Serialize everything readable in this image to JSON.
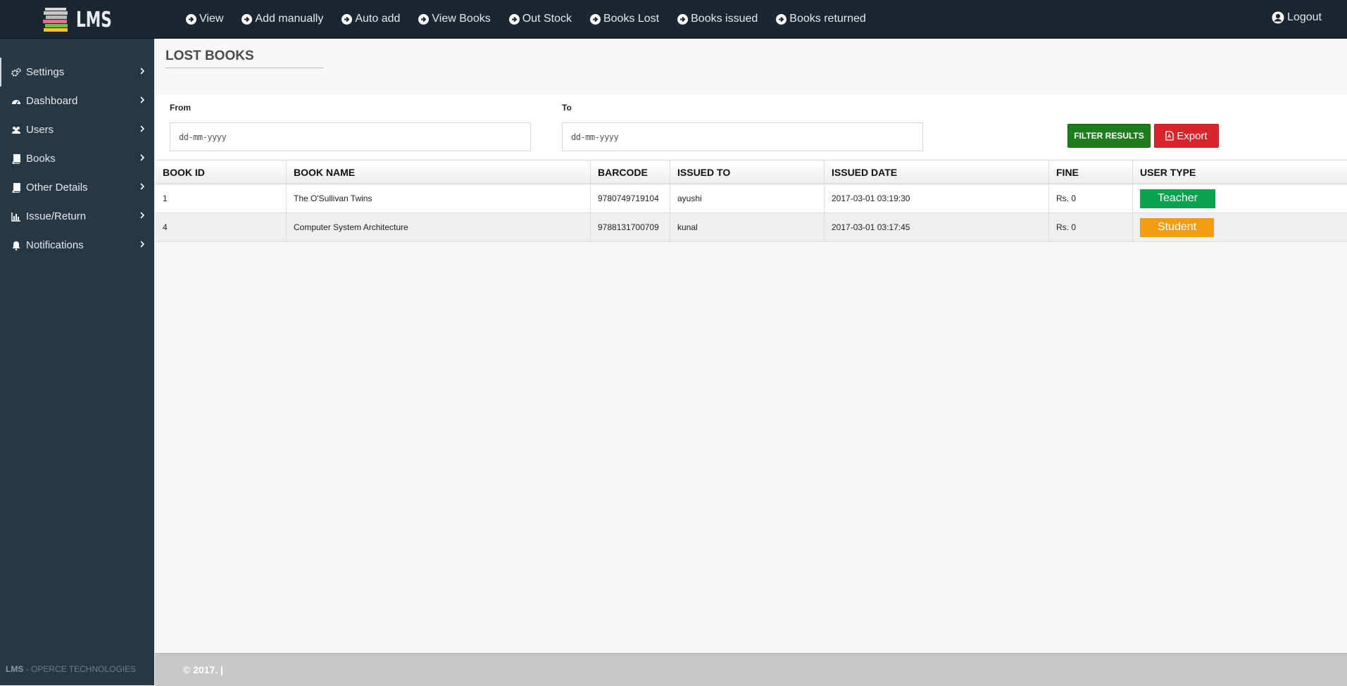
{
  "brand": {
    "name": "LMS"
  },
  "topnav": [
    {
      "label": "View"
    },
    {
      "label": "Add manually"
    },
    {
      "label": "Auto add"
    },
    {
      "label": "View Books"
    },
    {
      "label": "Out Stock"
    },
    {
      "label": "Books Lost"
    },
    {
      "label": "Books issued"
    },
    {
      "label": "Books returned"
    }
  ],
  "logout_label": "Logout",
  "sidebar": {
    "items": [
      {
        "label": "Settings",
        "icon": "cogs-icon"
      },
      {
        "label": "Dashboard",
        "icon": "dashboard-icon"
      },
      {
        "label": "Users",
        "icon": "users-icon"
      },
      {
        "label": "Books",
        "icon": "book-icon"
      },
      {
        "label": "Other Details",
        "icon": "book-icon"
      },
      {
        "label": "Issue/Return",
        "icon": "bar-chart-icon"
      },
      {
        "label": "Notifications",
        "icon": "bell-icon"
      }
    ],
    "footer_brand": "LMS",
    "footer_sep": " - ",
    "footer_company": "OPERCE TECHNOLOGIES"
  },
  "page": {
    "title": "LOST BOOKS"
  },
  "filter": {
    "from_label": "From",
    "from_value": "dd-mm-yyyy",
    "to_label": "To",
    "to_value": "dd-mm-yyyy",
    "filter_button": "FILTER RESULTS",
    "export_button": "Export"
  },
  "table": {
    "headers": [
      "BOOK ID",
      "BOOK NAME",
      "BARCODE",
      "ISSUED TO",
      "ISSUED DATE",
      "FINE",
      "USER TYPE"
    ],
    "rows": [
      {
        "book_id": "1",
        "book_name": "The O'Sullivan Twins",
        "barcode": "9780749719104",
        "issued_to": "ayushi",
        "issued_date": "2017-03-01 03:19:30",
        "fine": "Rs. 0",
        "user_type": "Teacher",
        "user_type_color": "#0aa24f"
      },
      {
        "book_id": "4",
        "book_name": "Computer System Architecture",
        "barcode": "9788131700709",
        "issued_to": "kunal",
        "issued_date": "2017-03-01 03:17:45",
        "fine": "Rs. 0",
        "user_type": "Student",
        "user_type_color": "#f39c12"
      }
    ]
  },
  "footer": {
    "text": "© 2017. |"
  },
  "colors": {
    "topbar": "#1c2631",
    "sidebar": "#263746",
    "filter_green": "#1e7e1e",
    "export_red": "#d9242c"
  }
}
